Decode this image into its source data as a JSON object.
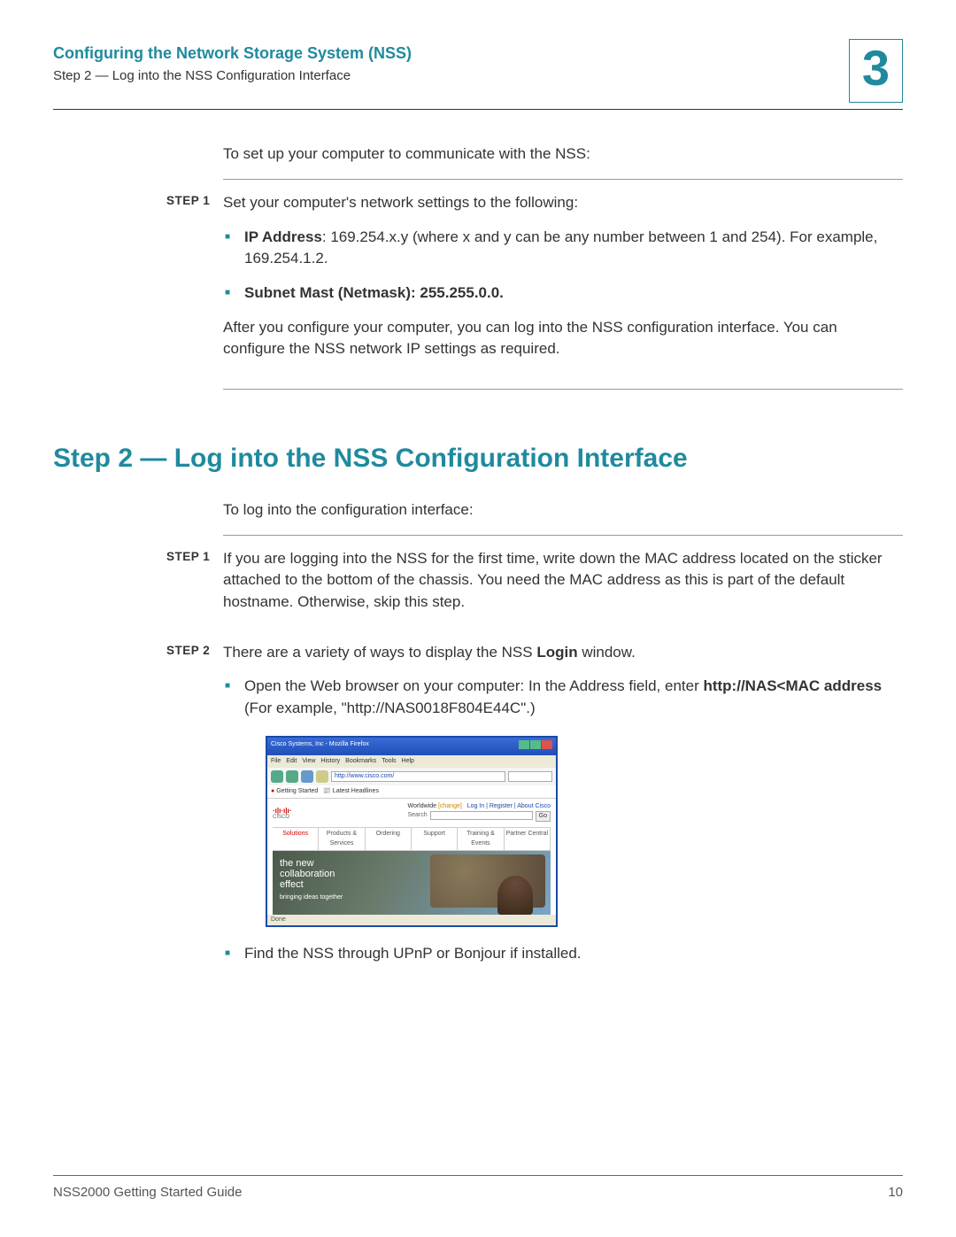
{
  "header": {
    "chapter_title": "Configuring the Network Storage System (NSS)",
    "breadcrumb": "Step 2 — Log into the NSS Configuration Interface",
    "chapter_number": "3"
  },
  "section1": {
    "intro": "To set up your computer to communicate with the NSS:",
    "step1_label": "STEP 1",
    "step1_text": "Set your computer's network settings to the following:",
    "bullet1_label": "IP Address",
    "bullet1_text": ": 169.254.x.y (where x and y can be any number between 1 and 254). For example, 169.254.1.2.",
    "bullet2_label": "Subnet Mast (Netmask)",
    "bullet2_text": ": 255.255.0.0.",
    "after_text": "After you configure your computer, you can log into the NSS configuration interface. You can configure the NSS network IP settings as required."
  },
  "section2": {
    "heading": "Step 2 — Log into the NSS Configuration Interface",
    "intro": "To log into the configuration interface:",
    "step1_label": "STEP 1",
    "step1_text": "If you are logging into the NSS for the first time, write down the MAC address located on the sticker attached to the bottom of the chassis. You need the MAC address as this is part of the default hostname. Otherwise, skip this step.",
    "step2_label": "STEP 2",
    "step2_text_pre": "There are a variety of ways to display the NSS ",
    "step2_text_bold": "Login",
    "step2_text_post": " window.",
    "bullet1_pre": "Open the Web browser on your computer: In the Address field, enter ",
    "bullet1_bold": "http://NAS<MAC address",
    "bullet1_post": " (For example, \"http://NAS0018F804E44C\".)",
    "bullet2": "Find the NSS through UPnP or Bonjour if installed."
  },
  "figure": {
    "titlebar": "Cisco Systems, Inc - Mozilla Firefox",
    "menus": [
      "File",
      "Edit",
      "View",
      "History",
      "Bookmarks",
      "Tools",
      "Help"
    ],
    "url": "http://www.cisco.com/",
    "bookmark1": "Getting Started",
    "bookmark2": "Latest Headlines",
    "logo_top": "·ı|ı·ı|ı·",
    "logo_bottom": "CISCO",
    "worldwide": "Worldwide",
    "change": "[change]",
    "links": "Log In  |  Register  |  About Cisco",
    "search_label": "Search",
    "go": "Go",
    "tabs": [
      "Solutions",
      "Products & Services",
      "Ordering",
      "Support",
      "Training & Events",
      "Partner Central"
    ],
    "hero_t1a": "the new",
    "hero_t1b": "collaboration",
    "hero_t1c": "effect",
    "hero_t2": "bringing ideas together",
    "status": "Done"
  },
  "footer": {
    "left": "NSS2000 Getting Started Guide",
    "right": "10"
  }
}
